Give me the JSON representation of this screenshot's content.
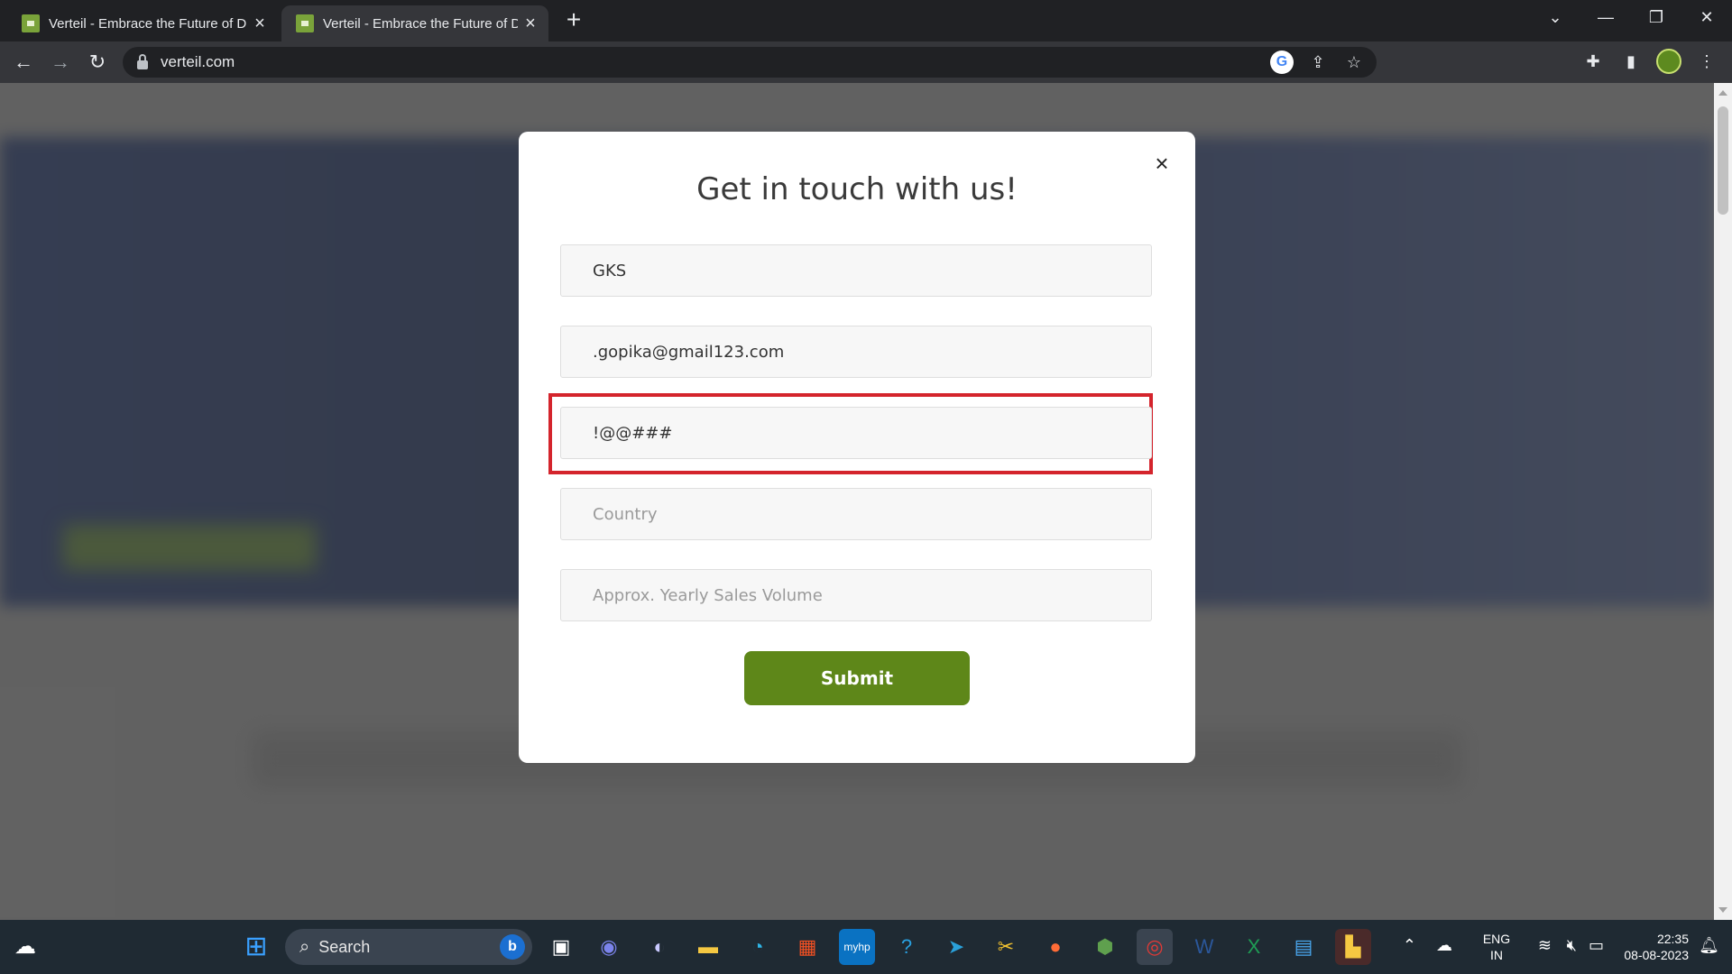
{
  "browser": {
    "tabs": [
      {
        "title": "Verteil - Embrace the Future of D",
        "active": false
      },
      {
        "title": "Verteil - Embrace the Future of D",
        "active": true
      }
    ],
    "new_tab_label": "+",
    "url": "verteil.com"
  },
  "modal": {
    "title": "Get in touch with us!",
    "close_label": "×",
    "fields": {
      "name_value": "GKS",
      "email_value": ".gopika@gmail123.com",
      "phone_value": "!@@###",
      "country_placeholder": "Country",
      "sales_placeholder": "Approx. Yearly Sales Volume"
    },
    "submit_label": "Submit",
    "highlight_color": "#d4242c",
    "accent_color": "#5e8719"
  },
  "taskbar": {
    "search_label": "Search",
    "language": {
      "line1": "ENG",
      "line2": "IN"
    },
    "clock": {
      "time": "22:35",
      "date": "08-08-2023"
    }
  }
}
